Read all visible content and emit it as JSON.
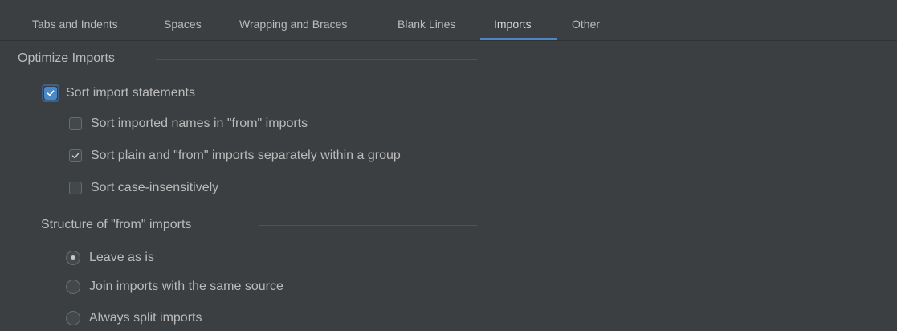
{
  "tabs": [
    {
      "label": "Tabs and Indents",
      "active": false
    },
    {
      "label": "Spaces",
      "active": false
    },
    {
      "label": "Wrapping and Braces",
      "active": false
    },
    {
      "label": "Blank Lines",
      "active": false
    },
    {
      "label": "Imports",
      "active": true
    },
    {
      "label": "Other",
      "active": false
    }
  ],
  "optimize": {
    "title": "Optimize Imports",
    "sort_statements": {
      "label": "Sort import statements",
      "checked": true
    },
    "sort_names_from": {
      "label": "Sort imported names in \"from\" imports",
      "checked": false
    },
    "sort_plain_from": {
      "label": "Sort plain and \"from\" imports separately within a group",
      "checked": true
    },
    "sort_case": {
      "label": "Sort case-insensitively",
      "checked": false
    }
  },
  "structure": {
    "title": "Structure of \"from\" imports",
    "options": [
      {
        "label": "Leave as is",
        "selected": true
      },
      {
        "label": "Join imports with the same source",
        "selected": false
      },
      {
        "label": "Always split imports",
        "selected": false
      }
    ]
  },
  "colors": {
    "background": "#3c3f41",
    "text": "#bbbbbb",
    "accent": "#4a88c7",
    "separator": "#4f5254"
  }
}
